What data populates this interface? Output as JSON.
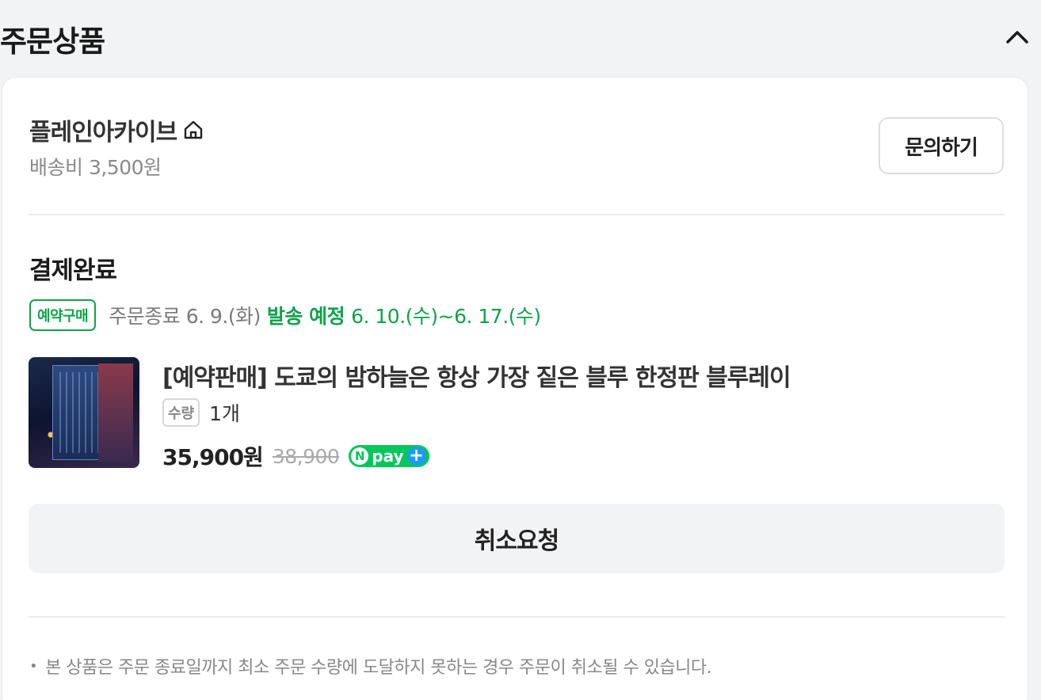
{
  "section": {
    "title": "주문상품",
    "collapse_icon": "chevron-up-icon"
  },
  "seller": {
    "name": "플레인아카이브",
    "home_icon": "home-icon",
    "shipping_fee": "배송비 3,500원",
    "inquiry_label": "문의하기"
  },
  "order": {
    "status": "결제완료",
    "preorder_badge": "예약구매",
    "close_date": "주문종료 6. 9.(화)",
    "ship_label": "발송 예정",
    "ship_range": "6. 10.(수)~6. 17.(수)"
  },
  "product": {
    "title": "[예약판매] 도쿄의 밤하늘은 항상 가장 짙은 블루 한정판 블루레이",
    "qty_label": "수량",
    "qty_value": "1개",
    "price": "35,900원",
    "original_price": "38,900",
    "npay_n": "N",
    "npay_text": "pay",
    "npay_plus": "+"
  },
  "actions": {
    "cancel_label": "취소요청"
  },
  "notice": {
    "bullet": "•",
    "text": "본 상품은 주문 종료일까지 최소 주문 수량에 도달하지 못하는 경우 주문이 취소될 수 있습니다."
  },
  "colors": {
    "accent_green": "#0fa34a",
    "npay_green": "#03c75a",
    "npay_blue": "#1e9bf0"
  }
}
